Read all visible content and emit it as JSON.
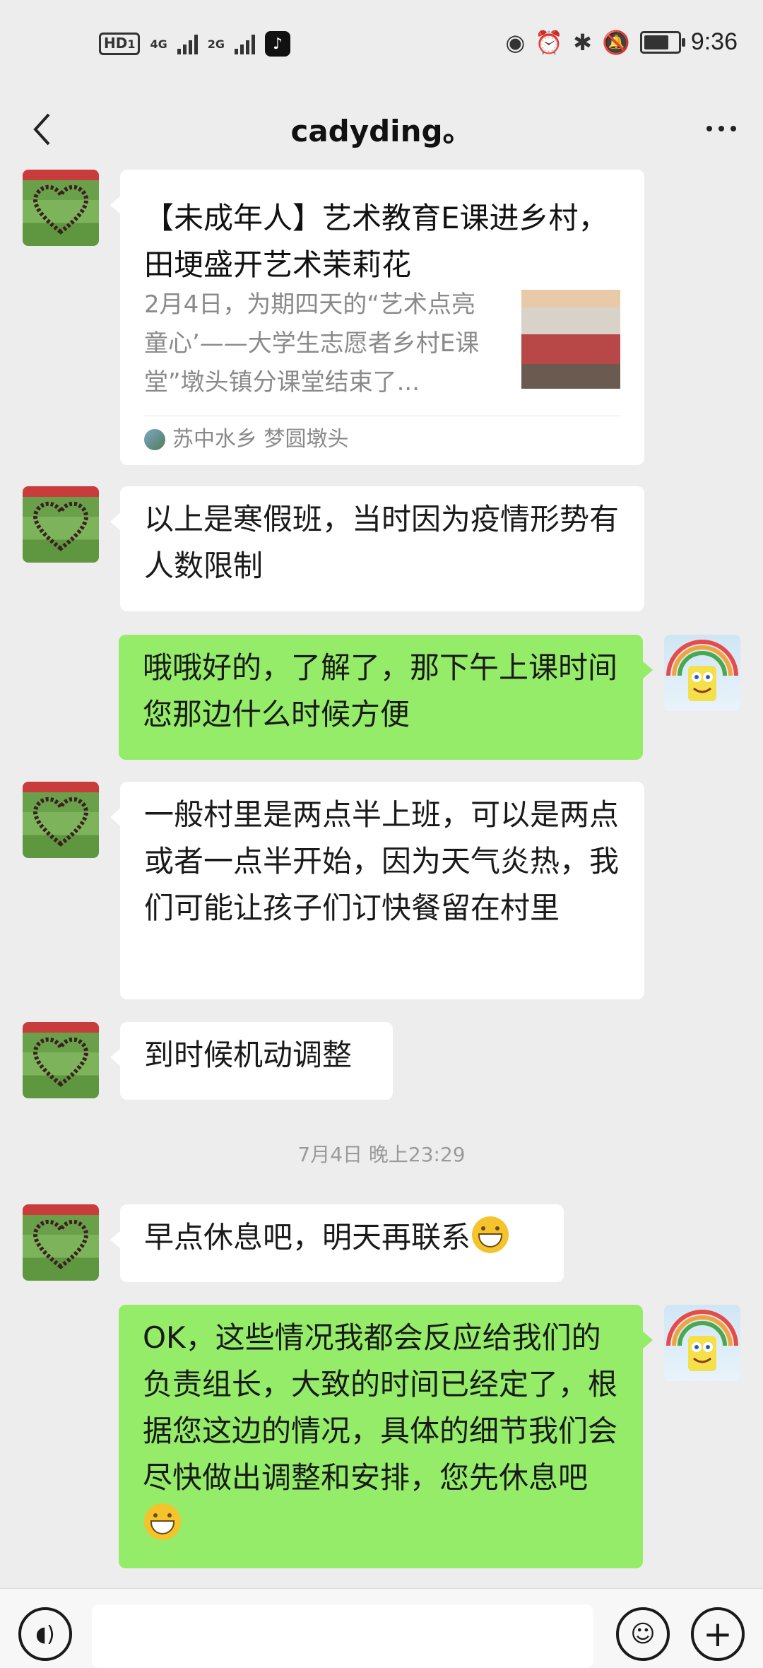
{
  "status_bar": {
    "hd": "HD",
    "hd_sub": "1",
    "net1": "4G",
    "net2": "2G",
    "time": "9:36",
    "battery_level": 0.85,
    "icons": [
      "hd-icon",
      "signal-icon",
      "tiktok-icon",
      "eye-icon",
      "alarm-icon",
      "bluetooth-icon",
      "mute-icon",
      "battery-icon"
    ]
  },
  "header": {
    "title": "cadyding。",
    "back_icon": "chevron-left-icon",
    "more_icon": "more-dots-icon"
  },
  "messages": [
    {
      "side": "left",
      "type": "article-card",
      "title": "【未成年人】艺术教育E课进乡村，田埂盛开艺术茉莉花",
      "description": "2月4日，为期四天的“艺术点亮童心’——大学生志愿者乡村E课堂”墩头镇分课堂结束了...",
      "source": "苏中水乡 梦圆墩头"
    },
    {
      "side": "left",
      "type": "text",
      "text": "以上是寒假班，当时因为疫情形势有人数限制"
    },
    {
      "side": "right",
      "type": "text",
      "text": "哦哦好的，了解了，那下午上课时间您那边什么时候方便"
    },
    {
      "side": "left",
      "type": "text",
      "text": "一般村里是两点半上班，可以是两点或者一点半开始，因为天气炎热，我们可能让孩子们订快餐留在村里"
    },
    {
      "side": "left",
      "type": "text",
      "text": "到时候机动调整"
    },
    {
      "type": "time",
      "text": "7月4日 晚上23:29"
    },
    {
      "side": "left",
      "type": "text",
      "text": "早点休息吧，明天再联系",
      "emoji": "grin-emoji"
    },
    {
      "side": "right",
      "type": "text",
      "text": "OK，这些情况我都会反应给我们的负责组长，大致的时间已经定了，根据您这边的情况，具体的细节我们会尽快做出调整和安排，您先休息吧",
      "emoji": "grin-emoji"
    }
  ],
  "input_bar": {
    "voice_icon": "voice-icon",
    "emoji_icon": "emoji-icon",
    "plus_icon": "plus-icon",
    "value": ""
  },
  "colors": {
    "background": "#ededed",
    "self_bubble": "#95ec69",
    "other_bubble": "#ffffff",
    "time_text": "#9a9a9a"
  }
}
